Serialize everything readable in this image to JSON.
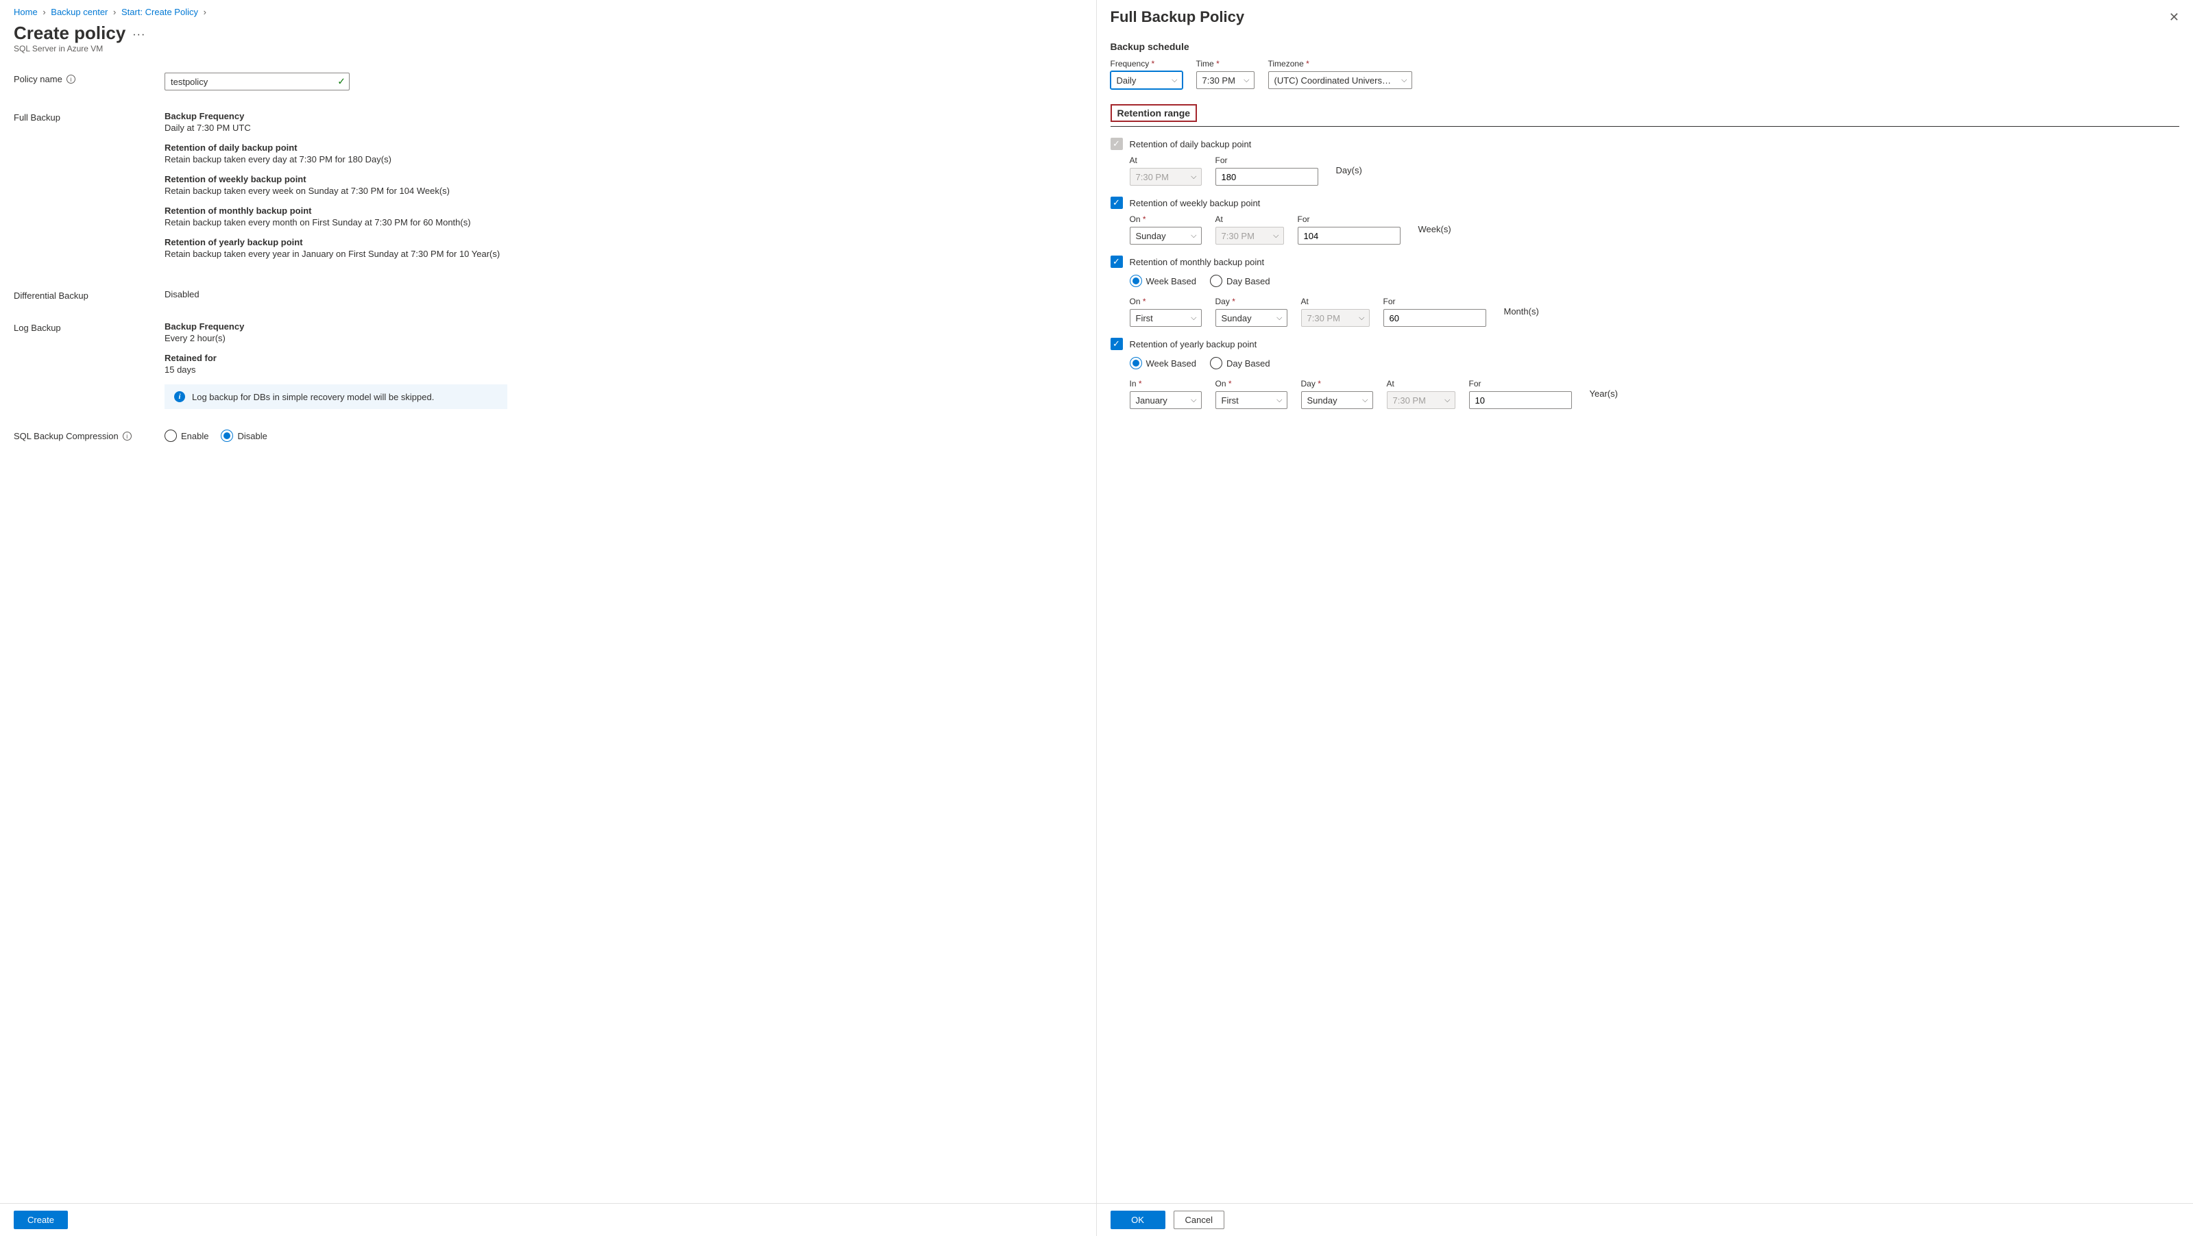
{
  "breadcrumb": {
    "items": [
      "Home",
      "Backup center",
      "Start: Create Policy"
    ]
  },
  "left": {
    "title": "Create policy",
    "subtitle": "SQL Server in Azure VM",
    "policy_name_label": "Policy name",
    "policy_name_value": "testpolicy",
    "full_backup_label": "Full Backup",
    "full_backup": {
      "freq_title": "Backup Frequency",
      "freq_desc": "Daily at 7:30 PM UTC",
      "daily_title": "Retention of daily backup point",
      "daily_desc": "Retain backup taken every day at 7:30 PM for 180 Day(s)",
      "weekly_title": "Retention of weekly backup point",
      "weekly_desc": "Retain backup taken every week on Sunday at 7:30 PM for 104 Week(s)",
      "monthly_title": "Retention of monthly backup point",
      "monthly_desc": "Retain backup taken every month on First Sunday at 7:30 PM for 60 Month(s)",
      "yearly_title": "Retention of yearly backup point",
      "yearly_desc": "Retain backup taken every year in January on First Sunday at 7:30 PM for 10 Year(s)"
    },
    "diff_label": "Differential Backup",
    "diff_value": "Disabled",
    "log_label": "Log Backup",
    "log": {
      "freq_title": "Backup Frequency",
      "freq_desc": "Every 2 hour(s)",
      "ret_title": "Retained for",
      "ret_desc": "15 days",
      "info": "Log backup for DBs in simple recovery model will be skipped."
    },
    "compression_label": "SQL Backup Compression",
    "compression_enable": "Enable",
    "compression_disable": "Disable",
    "create_button": "Create"
  },
  "right": {
    "title": "Full Backup Policy",
    "schedule_title": "Backup schedule",
    "frequency_label": "Frequency",
    "frequency_value": "Daily",
    "time_label": "Time",
    "time_value": "7:30 PM",
    "timezone_label": "Timezone",
    "timezone_value": "(UTC) Coordinated Universal Time",
    "retention_title": "Retention range",
    "daily": {
      "label": "Retention of daily backup point",
      "at_label": "At",
      "at_value": "7:30 PM",
      "for_label": "For",
      "for_value": "180",
      "unit": "Day(s)"
    },
    "weekly": {
      "label": "Retention of weekly backup point",
      "on_label": "On",
      "on_value": "Sunday",
      "at_label": "At",
      "at_value": "7:30 PM",
      "for_label": "For",
      "for_value": "104",
      "unit": "Week(s)"
    },
    "monthly": {
      "label": "Retention of monthly backup point",
      "week_based": "Week Based",
      "day_based": "Day Based",
      "on_label": "On",
      "on_value": "First",
      "day_label": "Day",
      "day_value": "Sunday",
      "at_label": "At",
      "at_value": "7:30 PM",
      "for_label": "For",
      "for_value": "60",
      "unit": "Month(s)"
    },
    "yearly": {
      "label": "Retention of yearly backup point",
      "week_based": "Week Based",
      "day_based": "Day Based",
      "in_label": "In",
      "in_value": "January",
      "on_label": "On",
      "on_value": "First",
      "day_label": "Day",
      "day_value": "Sunday",
      "at_label": "At",
      "at_value": "7:30 PM",
      "for_label": "For",
      "for_value": "10",
      "unit": "Year(s)"
    },
    "ok_button": "OK",
    "cancel_button": "Cancel"
  }
}
